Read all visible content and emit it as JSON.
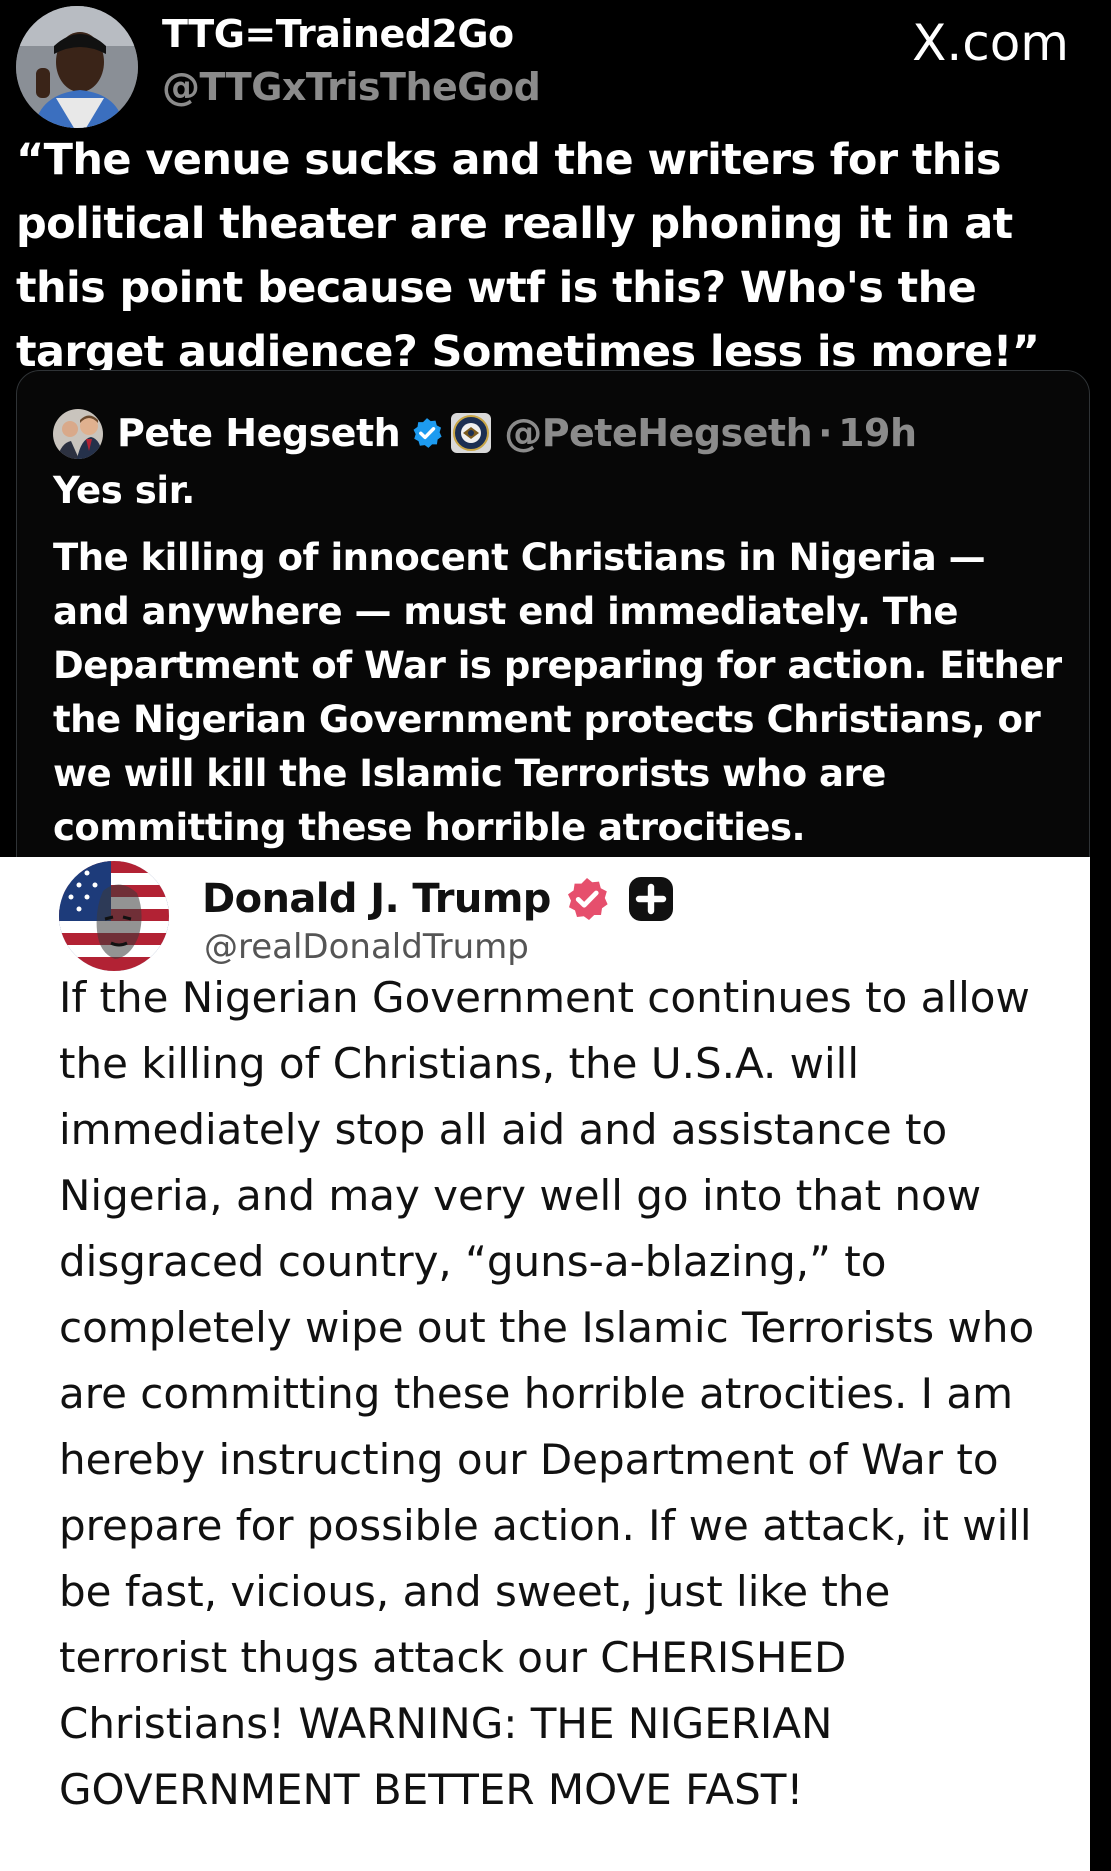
{
  "header": {
    "author_name": "TTG=Trained2Go",
    "author_handle": "@TTGxTrisTheGod",
    "site_label": "X.com"
  },
  "post": {
    "text": "“The venue sucks and the writers for this political theater are really phoning it in at this point because wtf is this? Who's the target audience? Sometimes less is more!”"
  },
  "quoted_post": {
    "name": "Pete Hegseth",
    "handle": "@PeteHegseth",
    "separator": "·",
    "time": "19h",
    "reply": "Yes sir.",
    "body": "The killing of innocent Christians in Nigeria — and anywhere — must end immediately. The Department of War is preparing for action. Either the Nigerian Government protects Christians, or we will kill the Islamic Terrorists who are committing these horrible atrocities."
  },
  "truth_post": {
    "name": "Donald J. Trump",
    "handle": "@realDonaldTrump",
    "body": "If the Nigerian Government continues to allow the killing of Christians, the U.S.A. will immediately stop all aid and assistance to Nigeria, and may very well go into that now disgraced country, “guns-a-blazing,” to completely wipe out the Islamic Terrorists who are committing these horrible atrocities. I am hereby instructing our Department of War to prepare for possible action. If we attack, it will be fast, vicious, and sweet, just like the terrorist thugs attack our CHERISHED Christians! WARNING: THE NIGERIAN GOVERNMENT BETTER MOVE FAST!"
  },
  "icons": {
    "quote_verified": "verified-badge-icon",
    "quote_org": "department-seal-icon",
    "truth_verified": "verified-badge-icon",
    "truth_plus": "plus-badge-icon"
  },
  "colors": {
    "background": "#000000",
    "muted_text": "#8b8b8b",
    "x_verified": "#1d9bf0",
    "truth_verified": "#e64f6d",
    "truth_card": "#ffffff"
  }
}
